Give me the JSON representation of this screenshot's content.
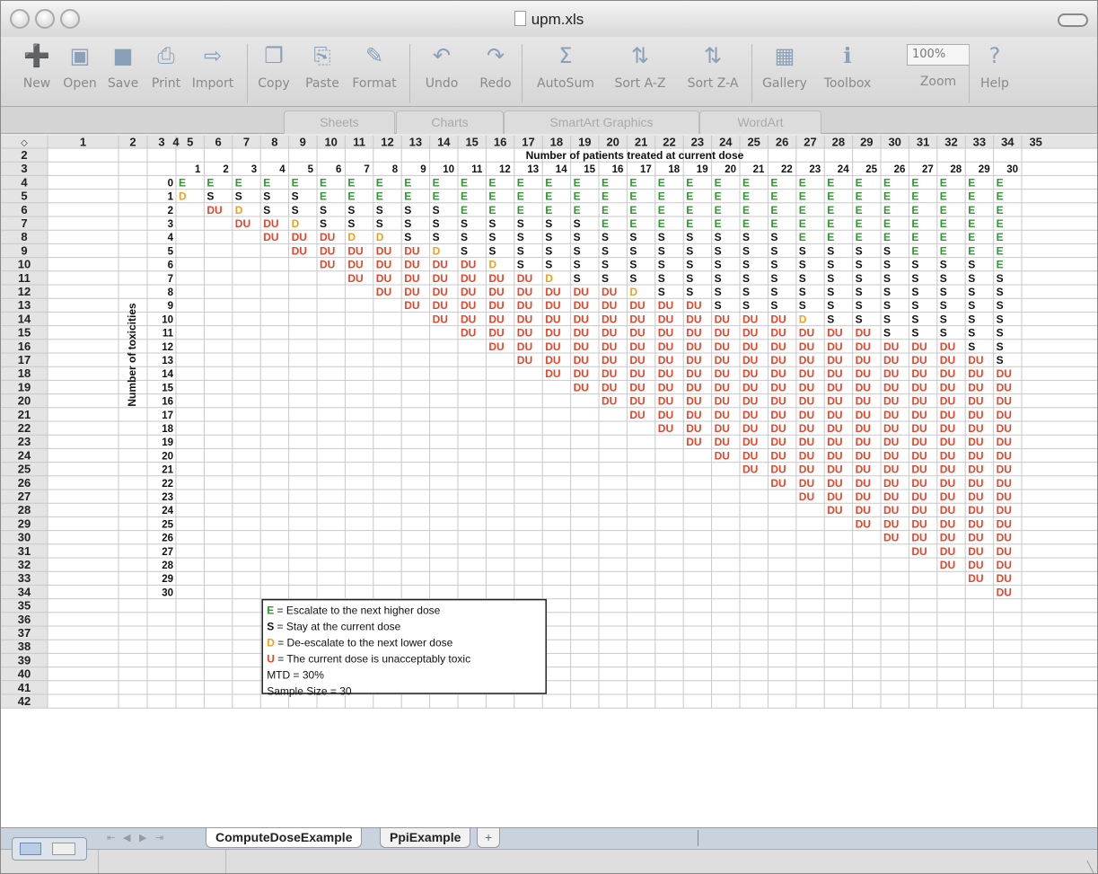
{
  "window": {
    "title": "upm.xls"
  },
  "toolbar": {
    "items": [
      {
        "label": "New",
        "icon": "new-icon"
      },
      {
        "label": "Open",
        "icon": "open-icon"
      },
      {
        "label": "Save",
        "icon": "save-icon"
      },
      {
        "label": "Print",
        "icon": "print-icon"
      },
      {
        "label": "Import",
        "icon": "import-icon"
      },
      {
        "label": "Copy",
        "icon": "copy-icon"
      },
      {
        "label": "Paste",
        "icon": "paste-icon"
      },
      {
        "label": "Format",
        "icon": "format-icon"
      },
      {
        "label": "Undo",
        "icon": "undo-icon"
      },
      {
        "label": "Redo",
        "icon": "redo-icon"
      },
      {
        "label": "AutoSum",
        "icon": "autosum-icon"
      },
      {
        "label": "Sort A-Z",
        "icon": "sort-az-icon"
      },
      {
        "label": "Sort Z-A",
        "icon": "sort-za-icon"
      },
      {
        "label": "Gallery",
        "icon": "gallery-icon"
      },
      {
        "label": "Toolbox",
        "icon": "toolbox-icon"
      },
      {
        "label": "Zoom",
        "icon": "zoom-icon"
      },
      {
        "label": "Help",
        "icon": "help-icon"
      }
    ],
    "zoom_value": "100%"
  },
  "ribbon": {
    "tabs": [
      "Sheets",
      "Charts",
      "SmartArt Graphics",
      "WordArt"
    ]
  },
  "sheet": {
    "column_headers": [
      "1",
      "2",
      "3",
      "4",
      "5",
      "6",
      "7",
      "8",
      "9",
      "10",
      "11",
      "12",
      "13",
      "14",
      "15",
      "16",
      "17",
      "18",
      "19",
      "20",
      "21",
      "22",
      "23",
      "24",
      "25",
      "26",
      "27",
      "28",
      "29",
      "30",
      "31",
      "32",
      "33",
      "34",
      "35"
    ],
    "row_headers": [
      "2",
      "3",
      "4",
      "5",
      "6",
      "7",
      "8",
      "9",
      "10",
      "11",
      "12",
      "13",
      "14",
      "15",
      "16",
      "17",
      "18",
      "19",
      "20",
      "21",
      "22",
      "23",
      "24",
      "25",
      "26",
      "27",
      "28",
      "29",
      "30",
      "31",
      "32",
      "33",
      "34",
      "35",
      "36",
      "37",
      "38",
      "39",
      "40",
      "41",
      "42"
    ],
    "title": "Number of patients treated at current dose",
    "ylabel": "Number of toxicities",
    "n_labels": [
      "1",
      "2",
      "3",
      "4",
      "5",
      "6",
      "7",
      "8",
      "9",
      "10",
      "11",
      "12",
      "13",
      "14",
      "15",
      "16",
      "17",
      "18",
      "19",
      "20",
      "21",
      "22",
      "23",
      "24",
      "25",
      "26",
      "27",
      "28",
      "29",
      "30"
    ],
    "k_labels": [
      "0",
      "1",
      "2",
      "3",
      "4",
      "5",
      "6",
      "7",
      "8",
      "9",
      "10",
      "11",
      "12",
      "13",
      "14",
      "15",
      "16",
      "17",
      "18",
      "19",
      "20",
      "21",
      "22",
      "23",
      "24",
      "25",
      "26",
      "27",
      "28",
      "29",
      "30"
    ],
    "rows": [
      "EEEEEEEEEEEEEEEEEEEEEEEEEEEEEE",
      "DSSSSEEEEEEEEEEEEEEEEEEEEEEEEE",
      " UDSSSSSSSEEEEEEEEEEEEEEEEEEEE",
      "  UUDSSSSSSSSSSEEEEEEEEEEEEEEE",
      "   UUUDDSSSSSSSSSSSSSSEEEEEEEE",
      "    UUUUUDSSSSSSSSSSSSSSSSEEEE",
      "     UUUUUUDSSSSSSSSSSSSSSSSSE",
      "      UUUUUUUDSSSSSSSSSSSSSSSS",
      "       UUUUUUUUUDSSSSSSSSSSSSS",
      "        UUUUUUUUUUUSSSSSSSSSSS",
      "         UUUUUUUUUUUUUDSSSSSSS",
      "          UUUUUUUUUUUUUUUSSSSS",
      "           UUUUUUUUUUUUUUUUUSS",
      "            UUUUUUUUUUUUUUUUUS",
      "             UUUUUUUUUUUUUUUUU",
      "              UUUUUUUUUUUUUUUU",
      "               UUUUUUUUUUUUUUU",
      "                UUUUUUUUUUUUUU",
      "                 UUUUUUUUUUUUU",
      "                  UUUUUUUUUUUU",
      "                   UUUUUUUUUUU",
      "                    UUUUUUUUUU",
      "                     UUUUUUUUU",
      "                      UUUUUUUU",
      "                       UUUUUUU",
      "                        UUUUUU",
      "                         UUUUU",
      "                          UUUU",
      "                           UUU",
      "                            UU",
      "                             U"
    ],
    "codes": {
      "E": "E",
      "S": "S",
      "D": "D",
      "U": "DU"
    },
    "colors": {
      "E": "#2e9a2e",
      "S": "#111111",
      "D": "#f0a020",
      "U": "#e8442a"
    },
    "legend": {
      "lines": [
        {
          "code": "E",
          "text": " = Escalate to the next higher dose",
          "color": "#2e9a2e"
        },
        {
          "code": "S",
          "text": " = Stay at the current dose",
          "color": "#111111"
        },
        {
          "code": "D",
          "text": " = De-escalate to the next lower dose",
          "color": "#f0a020"
        },
        {
          "code": "U",
          "text": " = The current dose is unacceptably toxic",
          "color": "#e8442a"
        }
      ],
      "mtd": "MTD = 30%",
      "sample_size": "Sample Size = 30"
    }
  },
  "sheet_tabs": {
    "tabs": [
      "ComputeDoseExample",
      "PpiExample"
    ],
    "add": "+"
  }
}
